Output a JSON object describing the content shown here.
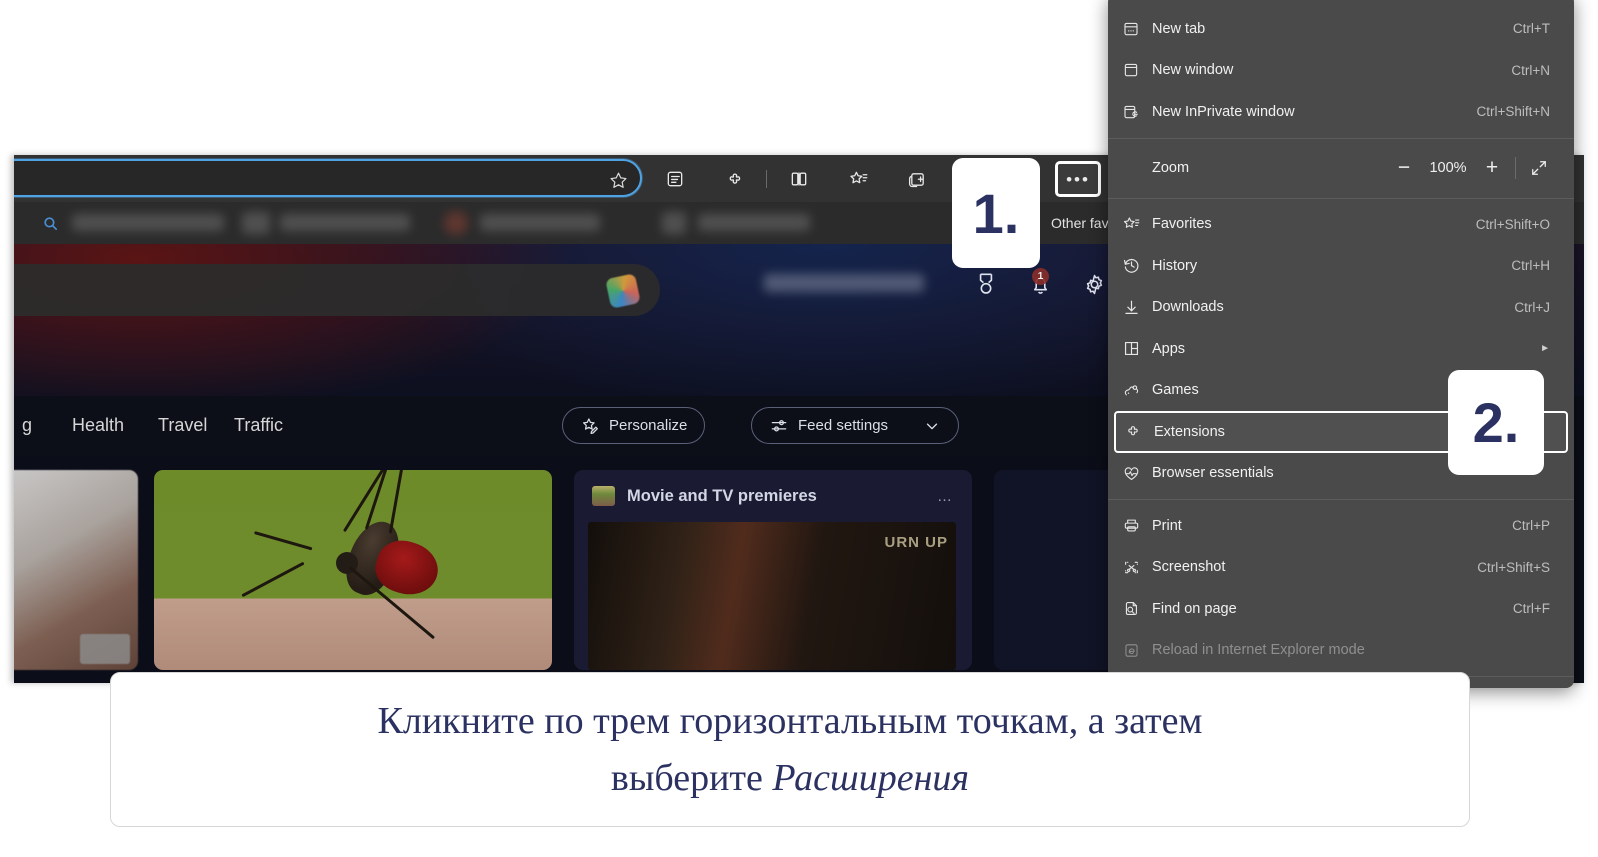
{
  "browser": {
    "address_bar": {
      "value": "",
      "placeholder": "",
      "favorite_icon": "star-icon"
    },
    "toolbar_icons": [
      {
        "name": "collections-icon",
        "label": "Collections"
      },
      {
        "name": "extensions-puzzle-icon",
        "label": "Extensions"
      },
      {
        "name": "split-screen-icon",
        "label": "Split screen"
      },
      {
        "name": "favorites-icon",
        "label": "Favorites"
      },
      {
        "name": "tab-actions-icon",
        "label": "Tab actions"
      }
    ],
    "more_button_label": "•••",
    "favorites_bar": {
      "other_favorites_label": "Other fav",
      "search_icon": "search-icon"
    }
  },
  "page": {
    "copilot_icon": "copilot-icon",
    "icons": [
      {
        "name": "rewards-medal-icon",
        "label": "Rewards"
      },
      {
        "name": "notifications-bell-icon",
        "label": "Notifications"
      },
      {
        "name": "settings-gear-icon",
        "label": "Settings"
      }
    ],
    "notification_badge": "1",
    "nav_links": [
      "g",
      "Health",
      "Travel",
      "Traffic"
    ],
    "personalize_button": "Personalize",
    "feed_settings_button": "Feed settings",
    "cards": [
      {
        "title": "",
        "name": "feed-card-left"
      },
      {
        "title": "",
        "name": "feed-card-mosquito"
      },
      {
        "title": "Movie and TV premieres",
        "name": "feed-card-movies",
        "more_label": "…",
        "photo_text": "URN UP"
      }
    ]
  },
  "menu": {
    "items": [
      {
        "icon": "new-tab-icon",
        "label": "New tab",
        "accel": "Ctrl+T",
        "disabled": false,
        "submenu": false
      },
      {
        "icon": "new-window-icon",
        "label": "New window",
        "accel": "Ctrl+N",
        "disabled": false,
        "submenu": false
      },
      {
        "icon": "inprivate-icon",
        "label": "New InPrivate window",
        "accel": "Ctrl+Shift+N",
        "disabled": false,
        "submenu": false
      }
    ],
    "zoom": {
      "label": "Zoom",
      "minus": "−",
      "value": "100%",
      "plus": "+",
      "fullscreen_icon": "fullscreen-icon"
    },
    "items2": [
      {
        "icon": "favorites-icon",
        "label": "Favorites",
        "accel": "Ctrl+Shift+O",
        "disabled": false,
        "submenu": false
      },
      {
        "icon": "history-icon",
        "label": "History",
        "accel": "Ctrl+H",
        "disabled": false,
        "submenu": false
      },
      {
        "icon": "downloads-icon",
        "label": "Downloads",
        "accel": "Ctrl+J",
        "disabled": false,
        "submenu": false
      },
      {
        "icon": "apps-icon",
        "label": "Apps",
        "accel": "",
        "disabled": false,
        "submenu": true
      },
      {
        "icon": "games-icon",
        "label": "Games",
        "accel": "",
        "disabled": false,
        "submenu": false
      }
    ],
    "highlighted_item": {
      "icon": "extensions-puzzle-icon",
      "label": "Extensions",
      "accel": "",
      "disabled": false,
      "submenu": false
    },
    "items3": [
      {
        "icon": "browser-essentials-icon",
        "label": "Browser essentials",
        "accel": "",
        "disabled": false,
        "submenu": false
      }
    ],
    "items4": [
      {
        "icon": "print-icon",
        "label": "Print",
        "accel": "Ctrl+P",
        "disabled": false,
        "submenu": false
      },
      {
        "icon": "screenshot-icon",
        "label": "Screenshot",
        "accel": "Ctrl+Shift+S",
        "disabled": false,
        "submenu": false
      },
      {
        "icon": "find-on-page-icon",
        "label": "Find on page",
        "accel": "Ctrl+F",
        "disabled": false,
        "submenu": false
      },
      {
        "icon": "internet-explorer-icon",
        "label": "Reload in Internet Explorer mode",
        "accel": "",
        "disabled": true,
        "submenu": false
      }
    ],
    "items5": [
      {
        "icon": "more-tools-icon",
        "label": "",
        "accel": "",
        "disabled": false,
        "submenu": true
      }
    ]
  },
  "callouts": {
    "step1": "1.",
    "step2": "2."
  },
  "caption": {
    "line1": "Кликните по трем горизонтальным точкам, а затем",
    "line2_prefix": "выберите ",
    "line2_emphasis": "Расширения"
  },
  "colors": {
    "menu_bg": "#4a4a4a",
    "toolbar_bg": "#323232",
    "accent_blue": "#4fa3e3",
    "callout_text": "#2b3161",
    "caption_text": "#2b3161"
  }
}
